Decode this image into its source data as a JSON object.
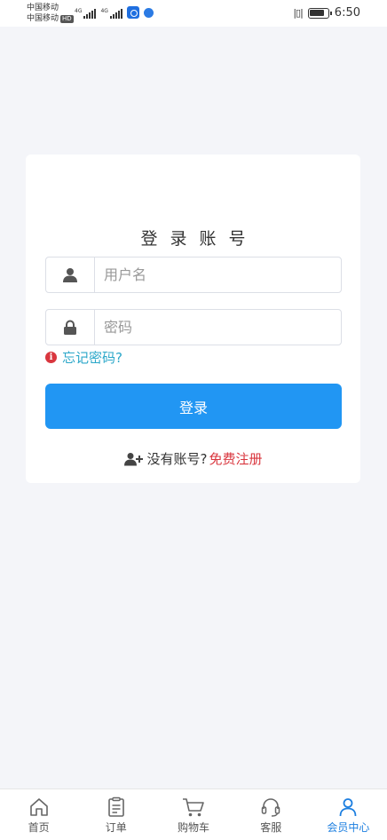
{
  "status_bar": {
    "carrier_1": "中国移动",
    "carrier_2": "中国移动",
    "hd_badge": "HD",
    "signal_1_tag": "4G",
    "signal_2_tag": "4G",
    "time": "6:50",
    "battery_level": 0.85
  },
  "login": {
    "title": "登录账号",
    "username_placeholder": "用户名",
    "password_placeholder": "密码",
    "forgot_password": "忘记密码?",
    "login_button": "登录",
    "no_account_text": "没有账号?",
    "register_link": "免费注册"
  },
  "colors": {
    "primary": "#2196f3",
    "link": "#2ba7c9",
    "danger": "#d9363e",
    "page_bg": "#f4f5f9"
  },
  "tabs": [
    {
      "label": "首页",
      "icon": "home-icon"
    },
    {
      "label": "订单",
      "icon": "order-icon"
    },
    {
      "label": "购物车",
      "icon": "cart-icon"
    },
    {
      "label": "客服",
      "icon": "headset-icon"
    },
    {
      "label": "会员中心",
      "icon": "user-icon",
      "active": true
    }
  ]
}
